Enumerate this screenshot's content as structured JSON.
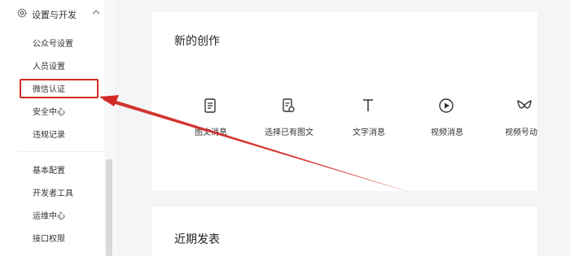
{
  "sidebar": {
    "section_title": "设置与开发",
    "items": [
      {
        "label": "公众号设置"
      },
      {
        "label": "人员设置"
      },
      {
        "label": "微信认证"
      },
      {
        "label": "安全中心"
      },
      {
        "label": "违规记录"
      },
      {
        "label": "基本配置"
      },
      {
        "label": "开发者工具"
      },
      {
        "label": "运维中心"
      },
      {
        "label": "接口权限"
      }
    ]
  },
  "main": {
    "create_panel": {
      "title": "新的创作",
      "items": [
        {
          "label": "图文消息",
          "icon": "document-icon"
        },
        {
          "label": "选择已有图文",
          "icon": "select-document-icon"
        },
        {
          "label": "文字消息",
          "icon": "text-icon"
        },
        {
          "label": "视频消息",
          "icon": "play-icon"
        },
        {
          "label": "视频号动",
          "icon": "channels-icon"
        }
      ]
    },
    "recent_panel": {
      "title": "近期发表"
    }
  },
  "annotation": {
    "color": "#d22a25"
  }
}
